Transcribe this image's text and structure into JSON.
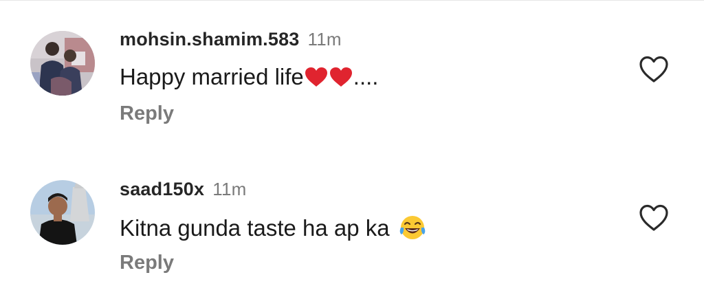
{
  "comments": [
    {
      "username": "mohsin.shamim.583",
      "time": "11m",
      "text": "Happy married life",
      "emojis": [
        "red-heart",
        "red-heart"
      ],
      "suffix": "....",
      "reply_label": "Reply"
    },
    {
      "username": "saad150x",
      "time": "11m",
      "text": "Kitna gunda taste ha ap ka ",
      "emojis": [
        "face-with-tears-of-joy"
      ],
      "suffix": "",
      "reply_label": "Reply"
    }
  ],
  "colors": {
    "username": "#262626",
    "secondary": "#7a7a7a",
    "heart_emoji": "#e0242f",
    "icon_stroke": "#2a2a2a"
  },
  "icons": {
    "like": "heart-outline-icon"
  }
}
